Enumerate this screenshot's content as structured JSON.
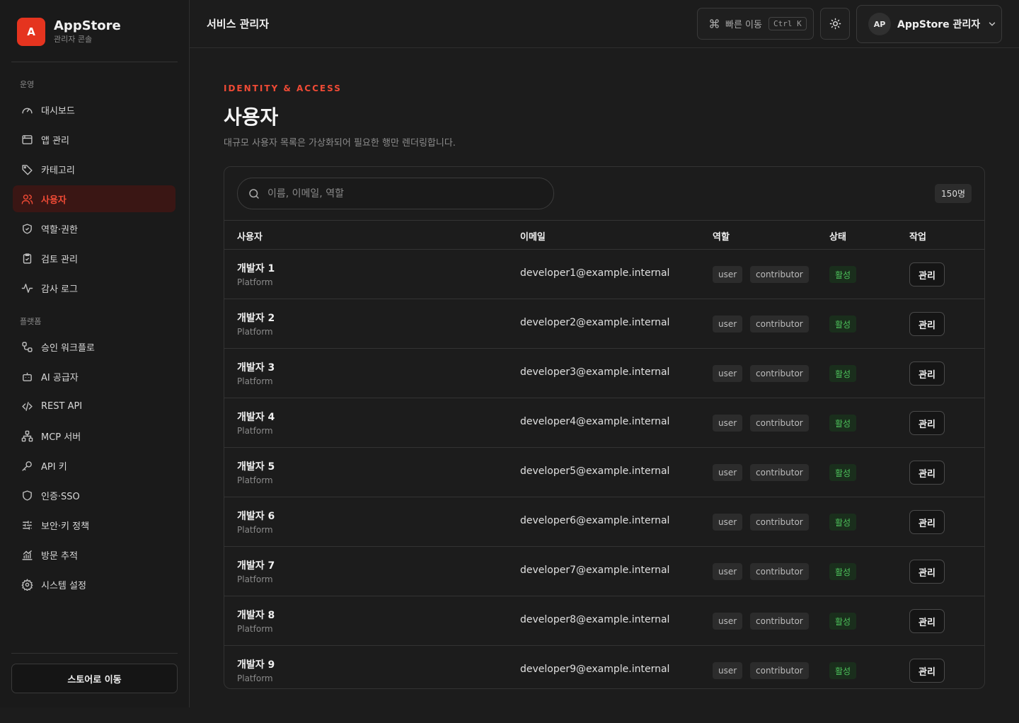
{
  "brand": {
    "logo_letter": "A",
    "name": "AppStore",
    "subtitle": "관리자 콘솔",
    "accent": "#e5341f"
  },
  "sidebar": {
    "section_ops": "운영",
    "ops_items": [
      {
        "label": "대시보드",
        "icon": "gauge-icon"
      },
      {
        "label": "앱 관리",
        "icon": "window-icon"
      },
      {
        "label": "카테고리",
        "icon": "tag-icon"
      },
      {
        "label": "사용자",
        "icon": "users-icon",
        "active": true
      },
      {
        "label": "역할·권한",
        "icon": "shield-check-icon"
      },
      {
        "label": "검토 관리",
        "icon": "clipboard-check-icon"
      },
      {
        "label": "감사 로그",
        "icon": "activity-icon"
      }
    ],
    "section_platform": "플랫폼",
    "platform_items": [
      {
        "label": "승인 워크플로",
        "icon": "workflow-icon"
      },
      {
        "label": "AI 공급자",
        "icon": "bot-icon"
      },
      {
        "label": "REST API",
        "icon": "code-icon"
      },
      {
        "label": "MCP 서버",
        "icon": "network-icon"
      },
      {
        "label": "API 키",
        "icon": "key-icon"
      },
      {
        "label": "인증·SSO",
        "icon": "shield-icon"
      },
      {
        "label": "보안·키 정책",
        "icon": "sliders-icon"
      },
      {
        "label": "방문 추적",
        "icon": "chart-icon"
      },
      {
        "label": "시스템 설정",
        "icon": "gear-icon"
      }
    ],
    "store_button": "스토어로 이동"
  },
  "header": {
    "title": "서비스 관리자",
    "quick_nav": "빠른 이동",
    "shortcut": "Ctrl K",
    "user_initials": "AP",
    "user_name": "AppStore 관리자"
  },
  "page": {
    "eyebrow": "IDENTITY & ACCESS",
    "title": "사용자",
    "description": "대규모 사용자 목록은 가상화되어 필요한 행만 렌더링합니다."
  },
  "table": {
    "search_placeholder": "이름, 이메일, 역할",
    "count": "150명",
    "columns": {
      "user": "사용자",
      "email": "이메일",
      "role": "역할",
      "status": "상태",
      "action": "작업"
    },
    "rows": [
      {
        "name": "개발자 1",
        "team": "Platform",
        "email": "developer1@example.internal",
        "roles": [
          "user",
          "contributor"
        ],
        "status": "활성",
        "action": "관리"
      },
      {
        "name": "개발자 2",
        "team": "Platform",
        "email": "developer2@example.internal",
        "roles": [
          "user",
          "contributor"
        ],
        "status": "활성",
        "action": "관리"
      },
      {
        "name": "개발자 3",
        "team": "Platform",
        "email": "developer3@example.internal",
        "roles": [
          "user",
          "contributor"
        ],
        "status": "활성",
        "action": "관리"
      },
      {
        "name": "개발자 4",
        "team": "Platform",
        "email": "developer4@example.internal",
        "roles": [
          "user",
          "contributor"
        ],
        "status": "활성",
        "action": "관리"
      },
      {
        "name": "개발자 5",
        "team": "Platform",
        "email": "developer5@example.internal",
        "roles": [
          "user",
          "contributor"
        ],
        "status": "활성",
        "action": "관리"
      },
      {
        "name": "개발자 6",
        "team": "Platform",
        "email": "developer6@example.internal",
        "roles": [
          "user",
          "contributor"
        ],
        "status": "활성",
        "action": "관리"
      },
      {
        "name": "개발자 7",
        "team": "Platform",
        "email": "developer7@example.internal",
        "roles": [
          "user",
          "contributor"
        ],
        "status": "활성",
        "action": "관리"
      },
      {
        "name": "개발자 8",
        "team": "Platform",
        "email": "developer8@example.internal",
        "roles": [
          "user",
          "contributor"
        ],
        "status": "활성",
        "action": "관리"
      },
      {
        "name": "개발자 9",
        "team": "Platform",
        "email": "developer9@example.internal",
        "roles": [
          "user",
          "contributor"
        ],
        "status": "활성",
        "action": "관리"
      }
    ]
  }
}
